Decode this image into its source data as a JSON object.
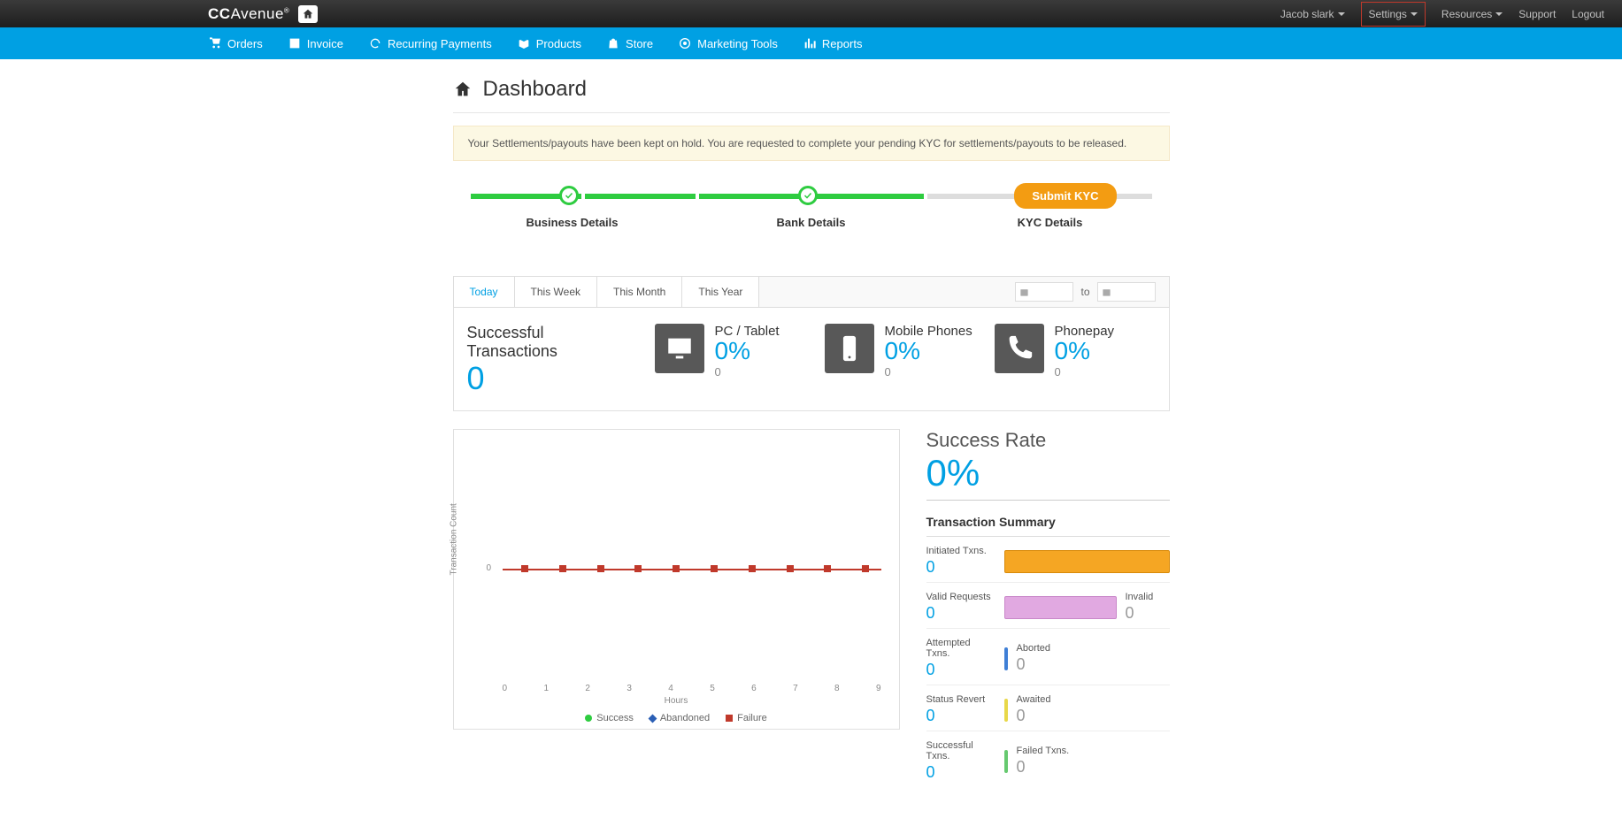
{
  "header": {
    "logo_cc": "CC",
    "logo_rest": "Avenue",
    "user": "Jacob slark",
    "settings": "Settings",
    "resources": "Resources",
    "support": "Support",
    "logout": "Logout"
  },
  "nav": {
    "orders": "Orders",
    "invoice": "Invoice",
    "recurring": "Recurring Payments",
    "products": "Products",
    "store": "Store",
    "marketing": "Marketing Tools",
    "reports": "Reports"
  },
  "page": {
    "title": "Dashboard"
  },
  "alert": "Your Settlements/payouts have been kept on hold. You are requested to complete your pending KYC for settlements/payouts to be released.",
  "steps": {
    "business": "Business Details",
    "bank": "Bank Details",
    "kyc": "KYC Details",
    "submit": "Submit KYC"
  },
  "filters": {
    "today": "Today",
    "week": "This Week",
    "month": "This Month",
    "year": "This Year",
    "to": "to"
  },
  "stats": {
    "success_label": "Successful Transactions",
    "success_val": "0",
    "pc_label": "PC / Tablet",
    "pc_pct": "0%",
    "pc_sub": "0",
    "mobile_label": "Mobile Phones",
    "mobile_pct": "0%",
    "mobile_sub": "0",
    "phonepay_label": "Phonepay",
    "phonepay_pct": "0%",
    "phonepay_sub": "0"
  },
  "chart_data": {
    "type": "line",
    "title": "",
    "xlabel": "Hours",
    "ylabel": "Transaction Count",
    "categories": [
      "0",
      "1",
      "2",
      "3",
      "4",
      "5",
      "6",
      "7",
      "8",
      "9"
    ],
    "ylim": [
      0,
      0
    ],
    "series": [
      {
        "name": "Success",
        "color": "#2ecc40",
        "values": [
          null,
          null,
          null,
          null,
          null,
          null,
          null,
          null,
          null,
          null
        ]
      },
      {
        "name": "Abandoned",
        "color": "#2b5fb5",
        "values": [
          null,
          null,
          null,
          null,
          null,
          null,
          null,
          null,
          null,
          null
        ]
      },
      {
        "name": "Failure",
        "color": "#c0392b",
        "values": [
          0,
          0,
          0,
          0,
          0,
          0,
          0,
          0,
          0,
          0
        ]
      }
    ],
    "ytick": "0"
  },
  "right": {
    "success_rate_label": "Success Rate",
    "success_rate_val": "0%",
    "summary_title": "Transaction Summary",
    "initiated": {
      "label": "Initiated Txns.",
      "val": "0"
    },
    "valid": {
      "label": "Valid Requests",
      "val": "0"
    },
    "invalid": {
      "label": "Invalid",
      "val": "0"
    },
    "attempted": {
      "label": "Attempted Txns.",
      "val": "0"
    },
    "aborted": {
      "label": "Aborted",
      "val": "0"
    },
    "status_revert": {
      "label": "Status Revert",
      "val": "0"
    },
    "awaited": {
      "label": "Awaited",
      "val": "0"
    },
    "successful": {
      "label": "Successful Txns.",
      "val": "0"
    },
    "failed": {
      "label": "Failed Txns.",
      "val": "0"
    }
  }
}
